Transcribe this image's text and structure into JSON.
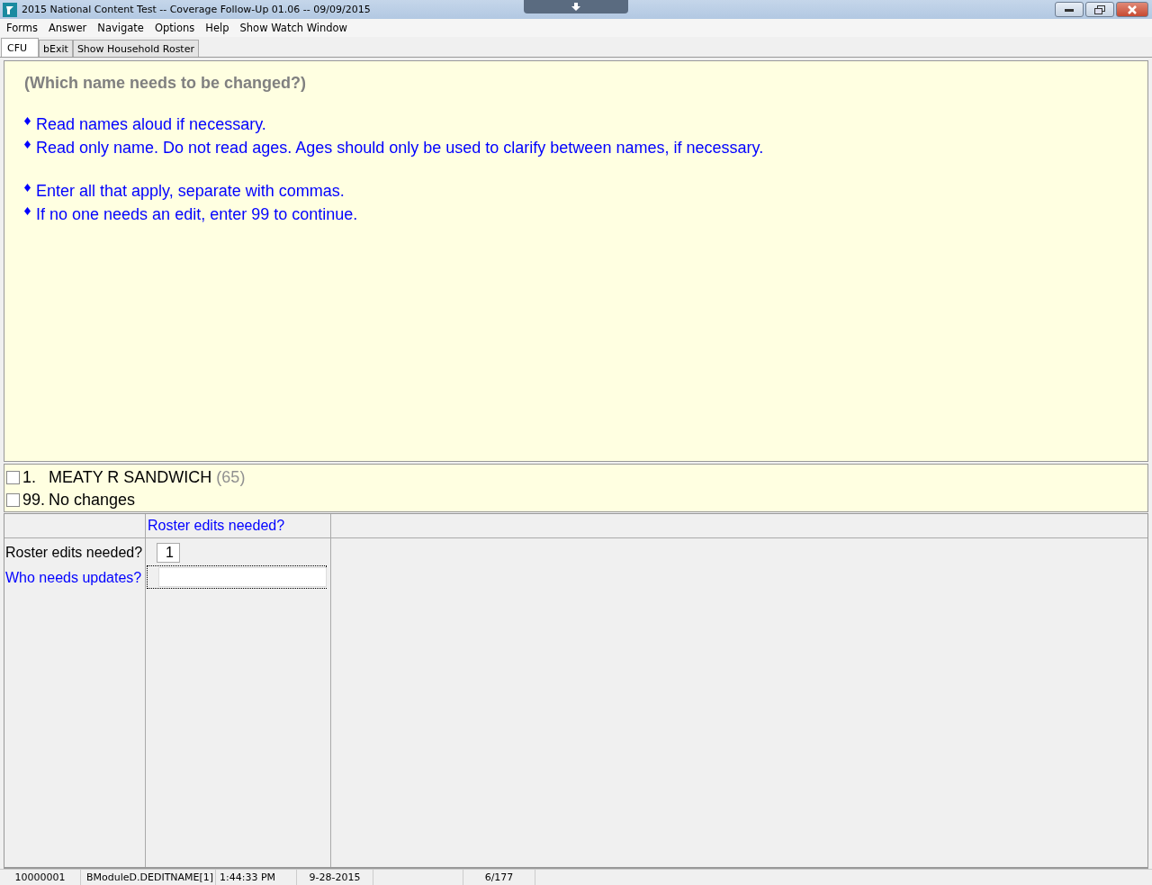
{
  "window": {
    "title": "2015 National Content Test -- Coverage Follow-Up 01.06 -- 09/09/2015"
  },
  "menu": [
    "Forms",
    "Answer",
    "Navigate",
    "Options",
    "Help",
    "Show Watch Window"
  ],
  "tabs": [
    {
      "label": "CFU",
      "selected": true
    },
    {
      "label": "bExit",
      "selected": false
    },
    {
      "label": "Show Household Roster",
      "selected": false
    }
  ],
  "question": "(Which name needs to be changed?)",
  "instruction_groups": [
    [
      "Read names aloud if necessary.",
      "Read only name. Do not read ages. Ages should only be used to clarify between names, if necessary."
    ],
    [
      "Enter all that apply, separate with commas.",
      "If no one needs an edit, enter 99 to continue."
    ]
  ],
  "answer_options": [
    {
      "number": "1.",
      "label": "MEATY R SANDWICH",
      "note": "(65)",
      "checked": false
    },
    {
      "number": "99.",
      "label": "No changes",
      "checked": false
    }
  ],
  "grid": {
    "header": "Roster edits needed?",
    "rows": [
      {
        "label": "Roster edits needed?",
        "value": "1",
        "selected": false
      },
      {
        "label": "Who needs updates?",
        "value": "",
        "selected": true
      }
    ]
  },
  "status_bar": [
    "10000001",
    "BModuleD.DEDITNAME[1]",
    "1:44:33 PM",
    "9-28-2015",
    "6/177"
  ]
}
